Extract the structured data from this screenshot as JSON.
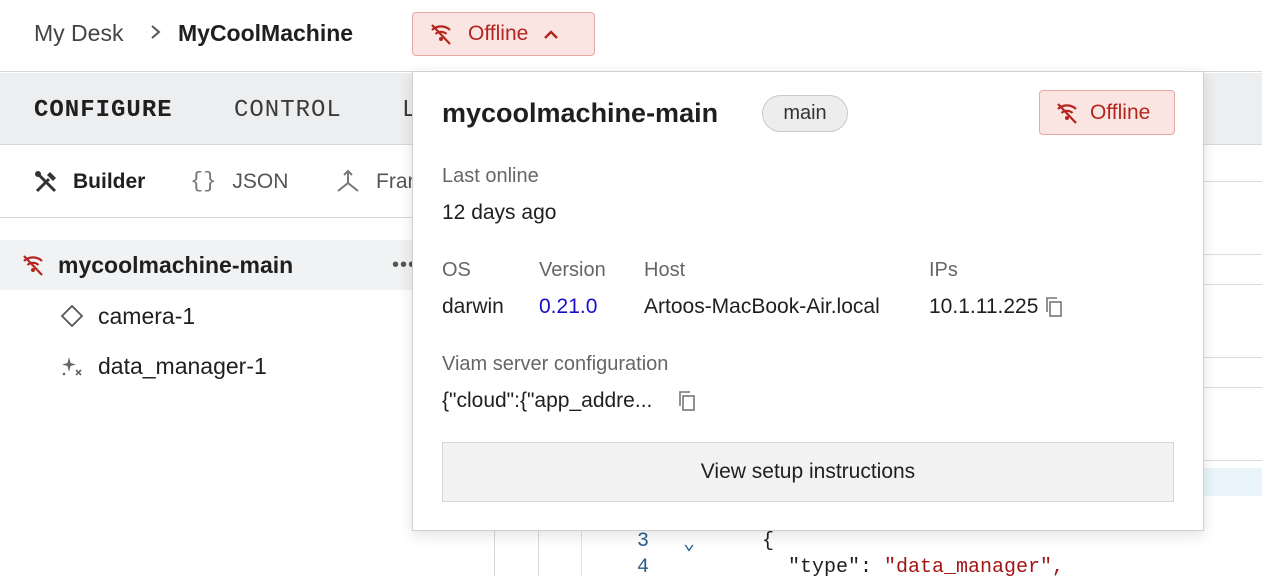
{
  "breadcrumb": {
    "parent": "My Desk",
    "current": "MyCoolMachine"
  },
  "status_button": {
    "label": "Offline",
    "icon": "wifi-off-icon",
    "color": "#b3261e"
  },
  "tabs": [
    {
      "label": "CONFIGURE",
      "active": true
    },
    {
      "label": "CONTROL",
      "active": false
    },
    {
      "label": "L",
      "active": false
    }
  ],
  "subtabs": [
    {
      "label": "Builder",
      "icon": "builder-tools-icon",
      "active": true
    },
    {
      "label": "JSON",
      "icon": "braces-icon",
      "active": false
    },
    {
      "label": "Fran",
      "icon": "frame-icon",
      "active": false
    }
  ],
  "tree": {
    "main": {
      "label": "mycoolmachine-main",
      "more": "•••"
    },
    "items": [
      {
        "label": "camera-1",
        "icon": "diamond-icon"
      },
      {
        "label": "data_manager-1",
        "icon": "sparkle-icon"
      }
    ]
  },
  "editor": {
    "lines": [
      {
        "num": "3",
        "fold": "⌄",
        "text": "{"
      },
      {
        "num": "4",
        "key": "\"type\": ",
        "value": "\"data_manager\","
      }
    ]
  },
  "popover": {
    "title": "mycoolmachine-main",
    "badge": "main",
    "status": "Offline",
    "last_online_label": "Last online",
    "last_online_value": "12 days ago",
    "os_label": "OS",
    "os_value": "darwin",
    "version_label": "Version",
    "version_value": "0.21.0",
    "host_label": "Host",
    "host_value": "Artoos-MacBook-Air.local",
    "ips_label": "IPs",
    "ips_value": "10.1.11.225",
    "config_label": "Viam server configuration",
    "config_value": "{\"cloud\":{\"app_addre...",
    "setup_button": "View setup instructions"
  }
}
